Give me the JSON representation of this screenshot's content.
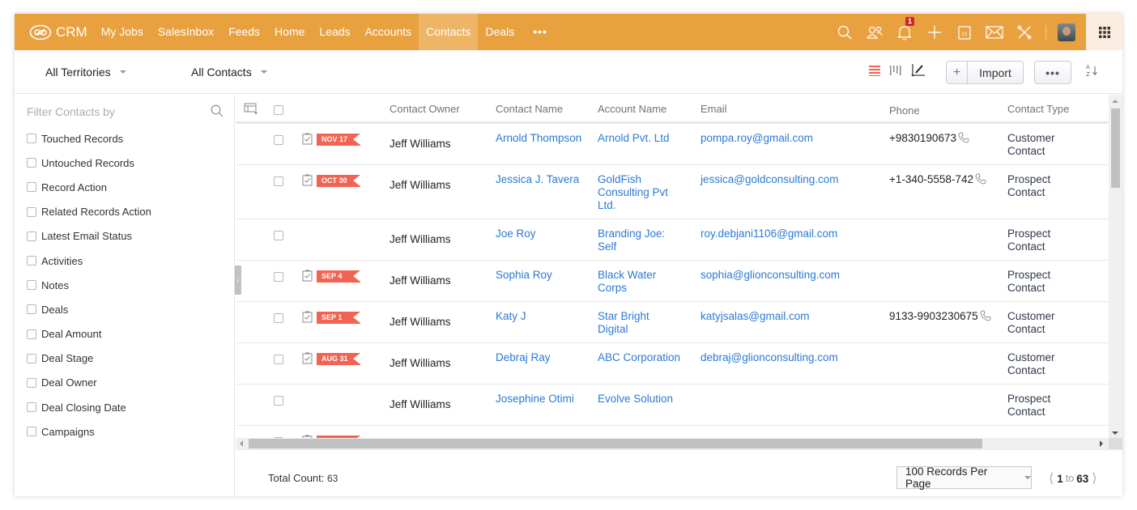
{
  "app": {
    "logo_text": "CRM",
    "accent_color": "#e9a140",
    "nav": [
      {
        "label": "My Jobs",
        "active": false
      },
      {
        "label": "SalesInbox",
        "active": false
      },
      {
        "label": "Feeds",
        "active": false
      },
      {
        "label": "Home",
        "active": false
      },
      {
        "label": "Leads",
        "active": false
      },
      {
        "label": "Accounts",
        "active": false
      },
      {
        "label": "Contacts",
        "active": true
      },
      {
        "label": "Deals",
        "active": false
      }
    ],
    "nav_more": "•••",
    "notification_count": "1",
    "top_icons": [
      "search-icon",
      "contacts-icon",
      "bell-icon",
      "plus-icon",
      "calendar-icon",
      "mail-icon",
      "setup-tools-icon",
      "avatar",
      "apps-grid-icon"
    ]
  },
  "toolbar": {
    "territory_filter": "All Territories",
    "view_filter": "All Contacts",
    "import_label": "Import",
    "import_plus": "+",
    "more_label": "•••"
  },
  "sidebar": {
    "title": "Filter Contacts by",
    "filters": [
      "Touched Records",
      "Untouched Records",
      "Record Action",
      "Related Records Action",
      "Latest Email Status",
      "Activities",
      "Notes",
      "Deals",
      "Deal Amount",
      "Deal Stage",
      "Deal Owner",
      "Deal Closing Date",
      "Campaigns"
    ]
  },
  "table": {
    "columns": [
      "Contact Owner",
      "Contact Name",
      "Account Name",
      "Email",
      "Phone",
      "Contact Type"
    ],
    "rows": [
      {
        "tag": "NOV 17",
        "owner": "Jeff Williams",
        "name": "Arnold Thompson",
        "account": "Arnold Pvt. Ltd",
        "email": "pompa.roy@gmail.com",
        "phone": "+9830190673",
        "type": "Customer Contact"
      },
      {
        "tag": "OCT 30",
        "owner": "Jeff Williams",
        "name": "Jessica J. Tavera",
        "account": "GoldFish Consulting Pvt Ltd.",
        "email": "jessica@goldconsulting.com",
        "phone": "+1-340-5558-742",
        "type": "Prospect Contact"
      },
      {
        "tag": "",
        "owner": "Jeff Williams",
        "name": "Joe Roy",
        "account": "Branding Joe: Self",
        "email": "roy.debjani1106@gmail.com",
        "phone": "",
        "type": "Prospect Contact"
      },
      {
        "tag": "SEP 4",
        "owner": "Jeff Williams",
        "name": "Sophia Roy",
        "account": "Black Water Corps",
        "email": "sophia@glionconsulting.com",
        "phone": "",
        "type": "Prospect Contact"
      },
      {
        "tag": "SEP 1",
        "owner": "Jeff Williams",
        "name": "Katy J",
        "account": "Star Bright Digital",
        "email": "katyjsalas@gmail.com",
        "phone": "9133-9903230675",
        "type": "Customer Contact"
      },
      {
        "tag": "AUG 31",
        "owner": "Jeff Williams",
        "name": "Debraj Ray",
        "account": "ABC Corporation",
        "email": "debraj@glionconsulting.com",
        "phone": "",
        "type": "Customer Contact"
      },
      {
        "tag": "",
        "owner": "Jeff Williams",
        "name": "Josephine Otimi",
        "account": "Evolve Solution",
        "email": "",
        "phone": "",
        "type": "Prospect Contact"
      }
    ],
    "tag_color": "#f26352",
    "link_color": "#2a7ad6"
  },
  "footer": {
    "total_label": "Total Count:",
    "total_value": "63",
    "per_page": "100 Records Per Page",
    "page_start": "1",
    "page_to": "to",
    "page_end": "63"
  }
}
